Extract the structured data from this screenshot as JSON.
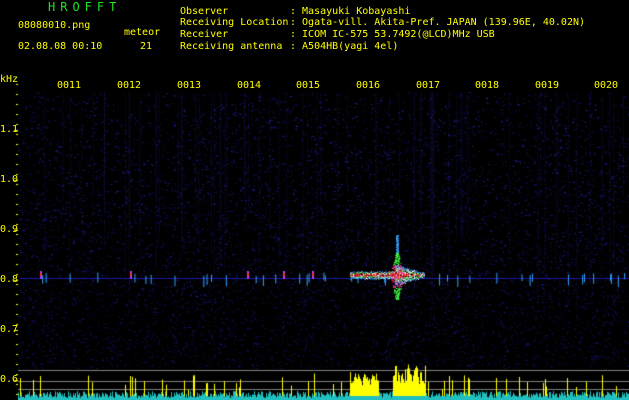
{
  "header": {
    "app_name": "HROFFT",
    "filename": "08080010.png",
    "datetime": "02.08.08 00:10",
    "meteor_label": "meteor",
    "meteor_count": "21",
    "fields": [
      {
        "label": "Observer",
        "value": ": Masayuki Kobayashi"
      },
      {
        "label": "Receiving Location",
        "value": ": Ogata-vill. Akita-Pref. JAPAN (139.96E, 40.02N)"
      },
      {
        "label": "Receiver",
        "value": ": ICOM IC-575 53.7492(@LCD)MHz USB"
      },
      {
        "label": "Receiving antenna",
        "value": ": A504HB(yagi 4el)"
      }
    ]
  },
  "spectrogram": {
    "y_unit": "kHz",
    "y_ticks": [
      "1.1",
      "1.0",
      "0.9",
      "0.8",
      "0.7",
      "0.6"
    ],
    "x_ticks": [
      "0011",
      "0012",
      "0013",
      "0014",
      "0015",
      "0016",
      "0017",
      "0018",
      "0019",
      "0020"
    ],
    "colors": {
      "background": "#000000",
      "noise": "#1a1aa0",
      "signal_line": "#30a0ff",
      "echo_hot": "#ff2020",
      "echo_mid": "#40ff40",
      "meter": "#ffff00",
      "meter_base": "#20c0c0"
    }
  }
}
